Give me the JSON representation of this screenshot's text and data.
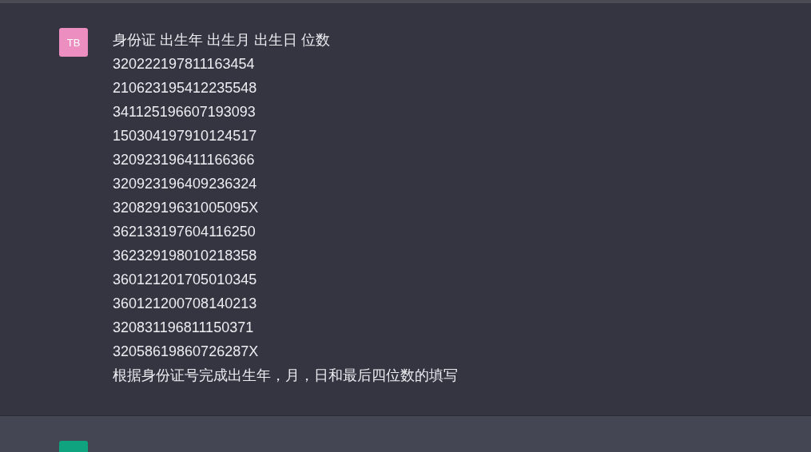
{
  "messages": [
    {
      "kind": "user",
      "avatar": "TB",
      "lines": [
        "身份证 出生年 出生月 出生日 位数",
        "320222197811163454",
        "210623195412235548",
        "341125196607193093",
        "150304197910124517",
        "320923196411166366",
        "320923196409236324",
        "32082919631005095X",
        "362133197604116250",
        "362329198010218358",
        "360121201705010345",
        "360121200708140213",
        "320831196811150371",
        "32058619860726287X",
        "根据身份证号完成出生年，月，日和最后四位数的填写"
      ]
    },
    {
      "kind": "assistant"
    }
  ]
}
